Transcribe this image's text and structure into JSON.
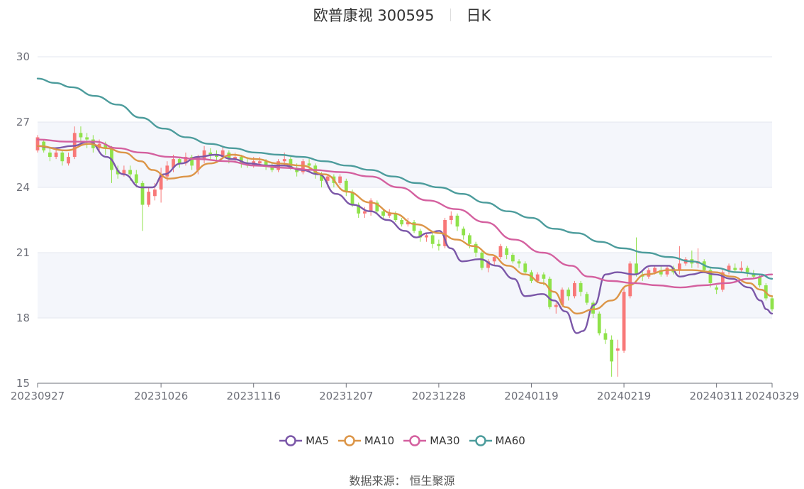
{
  "header": {
    "stock": "欧普康视 300595",
    "period": "日K"
  },
  "source": {
    "text": "数据来源：  恒生聚源"
  },
  "colors": {
    "up": "#f87878",
    "down": "#8fe24a",
    "MA5": "#7b57a8",
    "MA10": "#dc9547",
    "MA30": "#d4609f",
    "MA60": "#4c9c9c",
    "grid": "#e3e7ef",
    "band": "#f4f6fb"
  },
  "chart_data": {
    "type": "candlestick",
    "y_axis": {
      "min": 15,
      "max": 30,
      "ticks": [
        15,
        18,
        21,
        24,
        27,
        30
      ]
    },
    "x_axis": {
      "tick_labels": [
        "20230927",
        "20231026",
        "20231116",
        "20231207",
        "20231228",
        "20240119",
        "20240219",
        "20240311",
        "20240329"
      ],
      "tick_index": [
        0,
        20,
        35,
        50,
        65,
        80,
        95,
        110,
        119
      ],
      "count": 120
    },
    "legend": [
      "MA5",
      "MA10",
      "MA30",
      "MA60"
    ],
    "candles": [
      [
        25.7,
        26.3,
        26.4,
        25.6
      ],
      [
        26.1,
        25.7,
        26.2,
        25.6
      ],
      [
        25.6,
        25.4,
        25.8,
        25.2
      ],
      [
        25.4,
        25.6,
        25.8,
        25.3
      ],
      [
        25.6,
        25.2,
        25.7,
        25.0
      ],
      [
        25.1,
        25.4,
        25.6,
        25.0
      ],
      [
        25.4,
        26.5,
        26.8,
        25.3
      ],
      [
        26.5,
        26.3,
        26.8,
        26.0
      ],
      [
        26.3,
        26.2,
        26.5,
        25.8
      ],
      [
        26.2,
        25.8,
        26.4,
        25.6
      ],
      [
        25.8,
        26.0,
        26.2,
        25.6
      ],
      [
        26.0,
        25.8,
        26.1,
        25.5
      ],
      [
        25.8,
        24.8,
        25.9,
        24.2
      ],
      [
        24.8,
        24.6,
        25.0,
        24.4
      ],
      [
        24.6,
        24.8,
        25.0,
        24.5
      ],
      [
        24.8,
        24.6,
        25.0,
        24.3
      ],
      [
        24.6,
        24.2,
        24.8,
        24.0
      ],
      [
        24.2,
        23.2,
        24.3,
        22.0
      ],
      [
        23.2,
        23.8,
        24.0,
        23.1
      ],
      [
        23.6,
        23.9,
        24.2,
        23.4
      ],
      [
        23.9,
        24.6,
        24.9,
        23.3
      ],
      [
        24.5,
        25.0,
        25.2,
        24.3
      ],
      [
        24.9,
        25.3,
        25.5,
        24.7
      ],
      [
        25.3,
        25.1,
        25.4,
        24.9
      ],
      [
        25.1,
        25.4,
        25.6,
        25.0
      ],
      [
        25.4,
        25.0,
        25.5,
        24.8
      ],
      [
        24.8,
        25.4,
        25.5,
        24.6
      ],
      [
        25.3,
        25.7,
        25.9,
        25.1
      ],
      [
        25.6,
        25.5,
        25.8,
        25.3
      ],
      [
        25.5,
        25.4,
        25.7,
        25.2
      ],
      [
        25.4,
        25.7,
        25.9,
        25.3
      ],
      [
        25.6,
        25.3,
        25.7,
        25.1
      ],
      [
        25.3,
        25.4,
        25.6,
        25.2
      ],
      [
        25.4,
        25.1,
        25.5,
        24.9
      ],
      [
        25.1,
        25.0,
        25.3,
        24.9
      ],
      [
        25.0,
        25.2,
        25.4,
        24.9
      ],
      [
        25.1,
        25.2,
        25.4,
        25.0
      ],
      [
        25.2,
        25.0,
        25.3,
        24.8
      ],
      [
        25.0,
        24.8,
        25.1,
        24.7
      ],
      [
        24.8,
        25.2,
        25.3,
        24.7
      ],
      [
        25.2,
        25.3,
        25.6,
        25.0
      ],
      [
        25.3,
        24.9,
        25.4,
        24.8
      ],
      [
        24.9,
        24.7,
        25.1,
        24.5
      ],
      [
        24.7,
        25.2,
        25.3,
        24.6
      ],
      [
        25.1,
        25.0,
        25.3,
        24.8
      ],
      [
        25.0,
        24.6,
        25.1,
        24.4
      ],
      [
        24.6,
        24.3,
        24.7,
        24.0
      ],
      [
        24.3,
        24.5,
        24.6,
        24.0
      ],
      [
        24.5,
        24.2,
        24.6,
        24.0
      ],
      [
        24.2,
        24.5,
        24.6,
        24.1
      ],
      [
        24.3,
        23.8,
        24.4,
        23.6
      ],
      [
        23.8,
        23.2,
        23.9,
        23.1
      ],
      [
        23.2,
        22.8,
        23.3,
        22.6
      ],
      [
        22.8,
        22.9,
        23.1,
        22.6
      ],
      [
        22.9,
        23.4,
        23.5,
        22.7
      ],
      [
        23.3,
        22.9,
        23.4,
        22.8
      ],
      [
        22.9,
        22.7,
        23.0,
        22.5
      ],
      [
        22.7,
        22.8,
        23.0,
        22.6
      ],
      [
        22.8,
        22.5,
        22.9,
        22.4
      ],
      [
        22.5,
        22.3,
        22.6,
        22.2
      ],
      [
        22.3,
        22.4,
        22.6,
        22.2
      ],
      [
        22.4,
        22.0,
        22.5,
        21.9
      ],
      [
        22.0,
        21.7,
        22.1,
        21.5
      ],
      [
        21.7,
        21.8,
        21.9,
        21.5
      ],
      [
        21.8,
        21.4,
        21.9,
        21.2
      ],
      [
        21.4,
        21.3,
        21.6,
        21.1
      ],
      [
        21.3,
        22.5,
        22.6,
        21.2
      ],
      [
        22.5,
        22.7,
        22.9,
        22.3
      ],
      [
        22.7,
        22.2,
        22.8,
        22.0
      ],
      [
        22.1,
        21.8,
        22.2,
        21.6
      ],
      [
        21.8,
        21.4,
        21.9,
        21.2
      ],
      [
        21.4,
        21.0,
        21.5,
        20.8
      ],
      [
        21.0,
        20.3,
        21.1,
        20.2
      ],
      [
        20.3,
        20.6,
        20.7,
        20.1
      ],
      [
        20.6,
        20.8,
        20.9,
        20.4
      ],
      [
        20.8,
        21.3,
        21.4,
        20.7
      ],
      [
        21.2,
        20.9,
        21.3,
        20.7
      ],
      [
        20.9,
        20.6,
        21.0,
        20.5
      ],
      [
        20.6,
        20.5,
        20.7,
        20.3
      ],
      [
        20.5,
        20.1,
        20.6,
        20.0
      ],
      [
        20.1,
        19.7,
        20.2,
        19.6
      ],
      [
        19.7,
        20.0,
        20.1,
        19.6
      ],
      [
        20.0,
        19.8,
        20.1,
        19.5
      ],
      [
        19.8,
        18.5,
        19.9,
        18.4
      ],
      [
        18.5,
        18.6,
        18.7,
        18.2
      ],
      [
        18.6,
        19.3,
        19.4,
        18.5
      ],
      [
        19.3,
        19.0,
        19.4,
        18.8
      ],
      [
        19.0,
        19.6,
        19.7,
        18.9
      ],
      [
        19.6,
        19.2,
        19.7,
        19.0
      ],
      [
        19.1,
        18.7,
        19.2,
        18.6
      ],
      [
        18.7,
        18.2,
        18.8,
        18.0
      ],
      [
        18.2,
        17.3,
        18.3,
        17.2
      ],
      [
        17.3,
        17.0,
        17.5,
        16.8
      ],
      [
        17.0,
        16.0,
        17.2,
        15.3
      ],
      [
        16.5,
        16.6,
        17.0,
        15.3
      ],
      [
        16.5,
        19.2,
        19.4,
        16.4
      ],
      [
        19.0,
        20.5,
        20.6,
        18.9
      ],
      [
        20.5,
        20.0,
        21.7,
        19.9
      ],
      [
        20.0,
        19.9,
        20.2,
        19.7
      ],
      [
        19.9,
        20.2,
        20.3,
        19.8
      ],
      [
        20.1,
        20.3,
        20.4,
        20.0
      ],
      [
        20.2,
        20.0,
        20.4,
        19.9
      ],
      [
        20.0,
        20.3,
        20.4,
        19.9
      ],
      [
        20.3,
        20.1,
        20.4,
        20.0
      ],
      [
        20.2,
        20.5,
        21.3,
        20.0
      ],
      [
        20.5,
        20.7,
        20.8,
        20.4
      ],
      [
        20.7,
        20.5,
        21.1,
        20.3
      ],
      [
        20.5,
        20.6,
        21.2,
        20.3
      ],
      [
        20.6,
        20.2,
        20.7,
        20.1
      ],
      [
        20.2,
        19.6,
        20.3,
        19.4
      ],
      [
        19.4,
        19.3,
        19.5,
        19.1
      ],
      [
        19.3,
        20.1,
        20.2,
        19.2
      ],
      [
        20.2,
        20.4,
        20.5,
        20.0
      ],
      [
        20.3,
        20.2,
        20.5,
        20.1
      ],
      [
        20.2,
        20.3,
        20.6,
        20.1
      ],
      [
        20.3,
        20.1,
        20.4,
        19.9
      ],
      [
        20.0,
        19.9,
        20.2,
        19.8
      ],
      [
        19.9,
        19.5,
        20.0,
        19.4
      ],
      [
        19.5,
        18.9,
        19.6,
        18.8
      ],
      [
        18.9,
        18.4,
        19.0,
        18.3
      ]
    ],
    "ma": {
      "MA5": [
        [
          0,
          25.9
        ],
        [
          3,
          25.8
        ],
        [
          6,
          25.9
        ],
        [
          9,
          26.1
        ],
        [
          12,
          25.4
        ],
        [
          15,
          24.6
        ],
        [
          18,
          24.0
        ],
        [
          20,
          24.0
        ],
        [
          22,
          24.6
        ],
        [
          25,
          25.1
        ],
        [
          28,
          25.4
        ],
        [
          31,
          25.5
        ],
        [
          34,
          25.3
        ],
        [
          37,
          25.1
        ],
        [
          40,
          25.0
        ],
        [
          43,
          25.0
        ],
        [
          46,
          24.8
        ],
        [
          49,
          24.6
        ],
        [
          52,
          23.7
        ],
        [
          55,
          23.2
        ],
        [
          58,
          22.9
        ],
        [
          61,
          22.5
        ],
        [
          64,
          22.0
        ],
        [
          66,
          21.7
        ],
        [
          68,
          21.9
        ],
        [
          70,
          22.0
        ],
        [
          72,
          21.2
        ],
        [
          74,
          20.6
        ],
        [
          77,
          20.7
        ],
        [
          80,
          20.4
        ],
        [
          83,
          19.8
        ],
        [
          85,
          19.0
        ],
        [
          88,
          19.1
        ],
        [
          90,
          18.8
        ],
        [
          92,
          18.3
        ],
        [
          94,
          17.3
        ],
        [
          95,
          17.4
        ],
        [
          97,
          18.6
        ],
        [
          99,
          20.0
        ],
        [
          101,
          20.1
        ],
        [
          104,
          20.0
        ],
        [
          107,
          20.4
        ],
        [
          110,
          20.4
        ],
        [
          112,
          19.9
        ],
        [
          114,
          20.0
        ],
        [
          116,
          20.1
        ],
        [
          118,
          20.0
        ],
        [
          121,
          19.8
        ],
        [
          124,
          19.4
        ],
        [
          126,
          18.8
        ],
        [
          127,
          18.4
        ],
        [
          128,
          18.2
        ]
      ],
      "MA10": [
        [
          0,
          25.9
        ],
        [
          5,
          25.7
        ],
        [
          9,
          26.0
        ],
        [
          12,
          25.8
        ],
        [
          15,
          25.6
        ],
        [
          18,
          25.2
        ],
        [
          20,
          24.8
        ],
        [
          23,
          24.4
        ],
        [
          26,
          24.5
        ],
        [
          30,
          25.1
        ],
        [
          34,
          25.5
        ],
        [
          38,
          25.3
        ],
        [
          42,
          25.1
        ],
        [
          46,
          25.0
        ],
        [
          50,
          24.6
        ],
        [
          54,
          23.8
        ],
        [
          58,
          23.3
        ],
        [
          62,
          22.8
        ],
        [
          66,
          22.3
        ],
        [
          70,
          21.9
        ],
        [
          73,
          21.6
        ],
        [
          76,
          21.3
        ],
        [
          79,
          20.9
        ],
        [
          82,
          20.4
        ],
        [
          85,
          20.0
        ],
        [
          88,
          19.6
        ],
        [
          90,
          19.2
        ],
        [
          92,
          18.5
        ],
        [
          94,
          18.2
        ],
        [
          97,
          18.4
        ],
        [
          100,
          18.8
        ],
        [
          103,
          19.5
        ],
        [
          106,
          20.0
        ],
        [
          110,
          20.2
        ],
        [
          114,
          20.2
        ],
        [
          118,
          20.1
        ],
        [
          121,
          19.9
        ],
        [
          124,
          19.6
        ],
        [
          126,
          19.3
        ],
        [
          128,
          19.0
        ]
      ],
      "MA30": [
        [
          0,
          26.2
        ],
        [
          5,
          26.1
        ],
        [
          10,
          26.1
        ],
        [
          14,
          25.8
        ],
        [
          18,
          25.6
        ],
        [
          23,
          25.4
        ],
        [
          28,
          25.3
        ],
        [
          33,
          25.2
        ],
        [
          38,
          25.0
        ],
        [
          43,
          24.9
        ],
        [
          48,
          24.8
        ],
        [
          53,
          24.7
        ],
        [
          58,
          24.5
        ],
        [
          63,
          24.0
        ],
        [
          68,
          23.4
        ],
        [
          73,
          23.0
        ],
        [
          78,
          22.4
        ],
        [
          83,
          21.6
        ],
        [
          88,
          21.0
        ],
        [
          93,
          20.4
        ],
        [
          96,
          19.9
        ],
        [
          100,
          19.7
        ],
        [
          104,
          19.6
        ],
        [
          108,
          19.5
        ],
        [
          112,
          19.4
        ],
        [
          116,
          19.5
        ],
        [
          120,
          19.6
        ],
        [
          124,
          19.8
        ],
        [
          128,
          20.0
        ]
      ],
      "MA60": [
        [
          0,
          29.0
        ],
        [
          3,
          28.8
        ],
        [
          6,
          28.6
        ],
        [
          10,
          28.2
        ],
        [
          14,
          27.8
        ],
        [
          18,
          27.2
        ],
        [
          22,
          26.7
        ],
        [
          26,
          26.3
        ],
        [
          30,
          26.0
        ],
        [
          34,
          25.8
        ],
        [
          38,
          25.6
        ],
        [
          42,
          25.5
        ],
        [
          46,
          25.4
        ],
        [
          50,
          25.2
        ],
        [
          54,
          25.0
        ],
        [
          58,
          24.8
        ],
        [
          62,
          24.5
        ],
        [
          66,
          24.2
        ],
        [
          70,
          24.0
        ],
        [
          74,
          23.7
        ],
        [
          78,
          23.3
        ],
        [
          82,
          22.9
        ],
        [
          86,
          22.6
        ],
        [
          90,
          22.1
        ],
        [
          94,
          21.9
        ],
        [
          98,
          21.5
        ],
        [
          102,
          21.2
        ],
        [
          106,
          21.0
        ],
        [
          110,
          20.8
        ],
        [
          114,
          20.6
        ],
        [
          118,
          20.3
        ],
        [
          122,
          20.1
        ],
        [
          126,
          20.0
        ],
        [
          128,
          19.8
        ]
      ]
    }
  }
}
